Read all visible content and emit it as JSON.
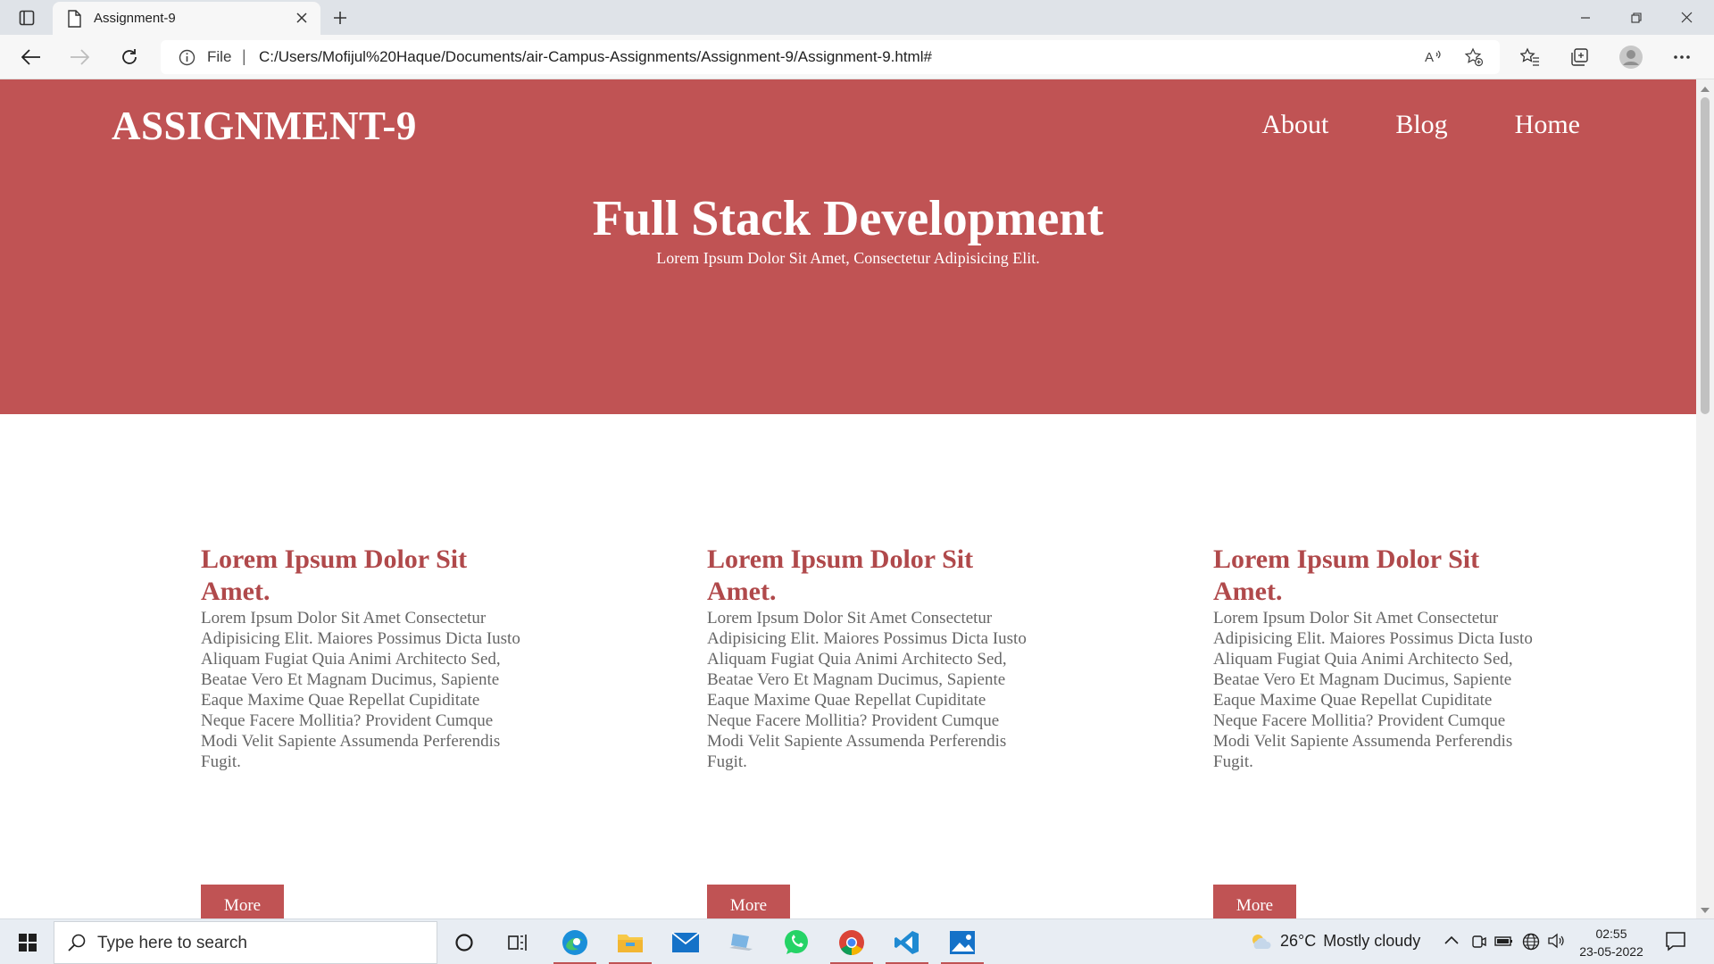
{
  "browser": {
    "tab_title": "Assignment-9",
    "omnibox_label": "File",
    "omnibox_separator": "|",
    "url": "C:/Users/Mofijul%20Haque/Documents/air-Campus-Assignments/Assignment-9/Assignment-9.html#"
  },
  "page": {
    "brand": "ASSIGNMENT-9",
    "nav": [
      "About",
      "Blog",
      "Home"
    ],
    "hero_title": "Full Stack Development",
    "hero_subtitle": "Lorem Ipsum Dolor Sit Amet, Consectetur Adipisicing Elit.",
    "cards": [
      {
        "title": "Lorem Ipsum Dolor Sit Amet.",
        "text": "Lorem Ipsum Dolor Sit Amet Consectetur Adipisicing Elit. Maiores Possimus Dicta Iusto Aliquam Fugiat Quia Animi Architecto Sed, Beatae Vero Et Magnam Ducimus, Sapiente Eaque Maxime Quae Repellat Cupiditate Neque Facere Mollitia? Provident Cumque Modi Velit Sapiente Assumenda Perferendis Fugit.",
        "button": "More"
      },
      {
        "title": "Lorem Ipsum Dolor Sit Amet.",
        "text": "Lorem Ipsum Dolor Sit Amet Consectetur Adipisicing Elit. Maiores Possimus Dicta Iusto Aliquam Fugiat Quia Animi Architecto Sed, Beatae Vero Et Magnam Ducimus, Sapiente Eaque Maxime Quae Repellat Cupiditate Neque Facere Mollitia? Provident Cumque Modi Velit Sapiente Assumenda Perferendis Fugit.",
        "button": "More"
      },
      {
        "title": "Lorem Ipsum Dolor Sit Amet.",
        "text": "Lorem Ipsum Dolor Sit Amet Consectetur Adipisicing Elit. Maiores Possimus Dicta Iusto Aliquam Fugiat Quia Animi Architecto Sed, Beatae Vero Et Magnam Ducimus, Sapiente Eaque Maxime Quae Repellat Cupiditate Neque Facere Mollitia? Provident Cumque Modi Velit Sapiente Assumenda Perferendis Fugit.",
        "button": "More"
      }
    ]
  },
  "taskbar": {
    "search_placeholder": "Type here to search",
    "weather_temp": "26°C",
    "weather_desc": "Mostly cloudy",
    "time": "02:55",
    "date": "23-05-2022",
    "apps": [
      "edge-icon",
      "file-explorer-icon",
      "mail-icon",
      "laptop-app-icon",
      "whatsapp-icon",
      "chrome-icon",
      "vscode-icon",
      "photos-icon"
    ]
  },
  "colors": {
    "brand": "#c05354",
    "card_title": "#b0494b",
    "body_text": "#666666"
  }
}
